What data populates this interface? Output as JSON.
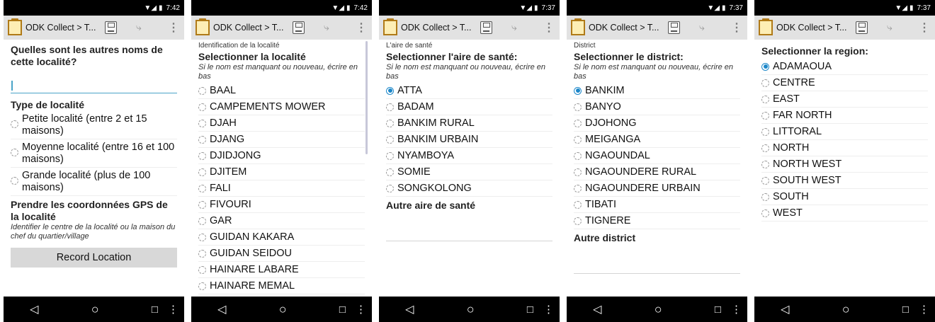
{
  "status": {
    "time_a": "7:42",
    "time_b": "7:37",
    "signal": "▼◢",
    "battery": "▮"
  },
  "app_title": "ODK Collect > T...",
  "nav": {
    "back": "◁",
    "home": "○",
    "recent": "□",
    "more": "⋮"
  },
  "screen1": {
    "q1_title": "Quelles sont les autres noms de cette localité?",
    "q2_title": "Type de localité",
    "q2_options": [
      "Petite localité (entre 2 et 15 maisons)",
      "Moyenne localité (entre 16 et 100 maisons)",
      "Grande localité (plus de 100 maisons)"
    ],
    "q3_title": "Prendre les coordonnées GPS de la localité",
    "q3_hint": "Identifier le centre de la localité ou la maison du chef du quartier/village",
    "record_button": "Record Location"
  },
  "screen2": {
    "group": "Identification de la localité",
    "title": "Selectionner la localité",
    "hint": "Si le nom est manquant ou nouveau, écrire en bas",
    "options": [
      "BAAL",
      "CAMPEMENTS MOWER",
      "DJAH",
      "DJANG",
      "DJIDJONG",
      "DJITEM",
      "FALI",
      "FIVOURI",
      "GAR",
      "GUIDAN KAKARA",
      "GUIDAN SEIDOU",
      "HAINARE LABARE",
      "HAINARE MEMAL"
    ]
  },
  "screen3": {
    "group": "L'aire de santé",
    "title": "Selectionner l'aire de santé:",
    "hint": "Si le nom est manquant ou nouveau, écrire en bas",
    "options": [
      "ATTA",
      "BADAM",
      "BANKIM RURAL",
      "BANKIM URBAIN",
      "NYAMBOYA",
      "SOMIE",
      "SONGKOLONG"
    ],
    "selected": "ATTA",
    "other_title": "Autre aire de santé"
  },
  "screen4": {
    "group": "District",
    "title": "Selectionner le district:",
    "hint": "Si le nom est manquant ou nouveau, écrire en bas",
    "options": [
      "BANKIM",
      "BANYO",
      "DJOHONG",
      "MEIGANGA",
      "NGAOUNDAL",
      "NGAOUNDERE RURAL",
      "NGAOUNDERE URBAIN",
      "TIBATI",
      "TIGNERE"
    ],
    "selected": "BANKIM",
    "other_title": "Autre district"
  },
  "screen5": {
    "title": "Selectionner la region:",
    "options": [
      "ADAMAOUA",
      "CENTRE",
      "EAST",
      "FAR NORTH",
      "LITTORAL",
      "NORTH",
      "NORTH WEST",
      "SOUTH WEST",
      "SOUTH",
      "WEST"
    ],
    "selected": "ADAMAOUA"
  },
  "colors": {
    "accent": "#1c87c9",
    "appbar": "#e2e2e2",
    "system_bar": "#000000",
    "logo": "#b07a17"
  },
  "icons": [
    "clipboard-logo-icon",
    "save-form-icon",
    "hierarchy-icon",
    "overflow-menu-icon",
    "nav-back-icon",
    "nav-home-icon",
    "nav-recents-icon"
  ]
}
